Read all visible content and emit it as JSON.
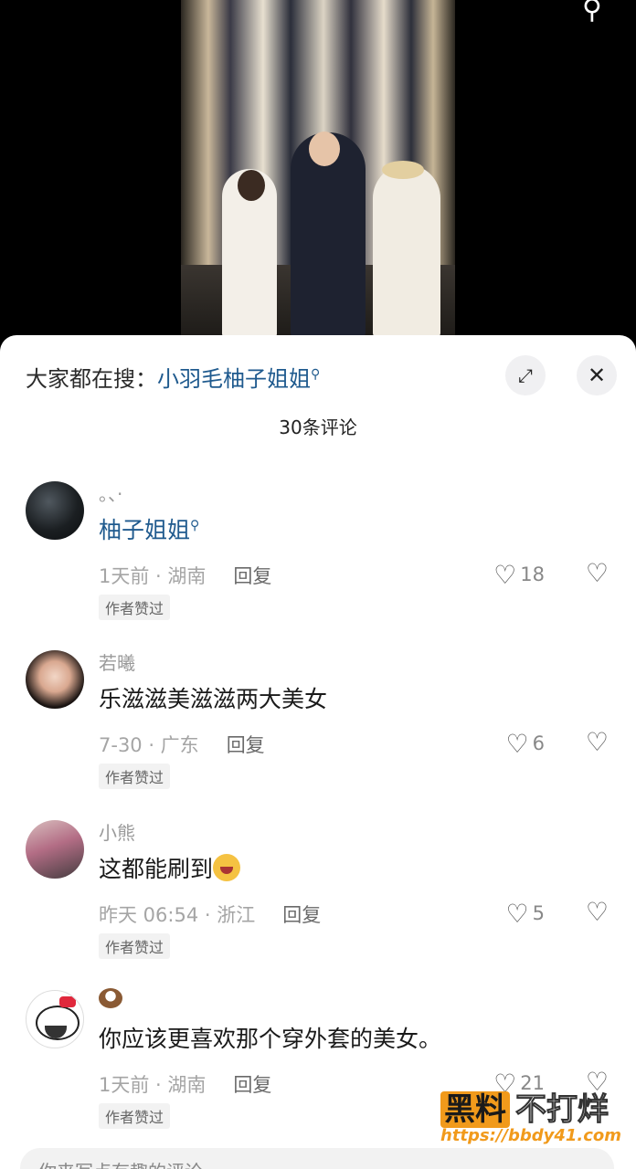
{
  "video": {
    "search_icon": "search-icon"
  },
  "panel": {
    "hot_search_prefix": "大家都在搜：",
    "hot_search_keyword": "小羽毛柚子姐姐",
    "expand_icon": "⤢",
    "close_icon": "✕",
    "comment_count": "30条评论"
  },
  "comments": [
    {
      "username": "。、·",
      "text": "柚子姐姐",
      "time_location": "1天前 · 湖南",
      "reply": "回复",
      "badge": "作者赞过",
      "likes": "18"
    },
    {
      "username": "若曦",
      "text": "乐滋滋美滋滋两大美女",
      "time_location": "7-30 · 广东",
      "reply": "回复",
      "badge": "作者赞过",
      "likes": "6"
    },
    {
      "username": "小熊",
      "text": "这都能刷到",
      "time_location": "昨天 06:54 · 浙江",
      "reply": "回复",
      "badge": "作者赞过",
      "likes": "5"
    },
    {
      "username": "",
      "text": "你应该更喜欢那个穿外套的美女。",
      "time_location": "1天前 · 湖南",
      "reply": "回复",
      "badge": "作者赞过",
      "likes": "21"
    }
  ],
  "input": {
    "placeholder": "你来写点有趣的评论"
  },
  "watermark": {
    "brand_a": "黑料",
    "brand_b": "不打烊",
    "url": "https://bbdy41.com"
  }
}
